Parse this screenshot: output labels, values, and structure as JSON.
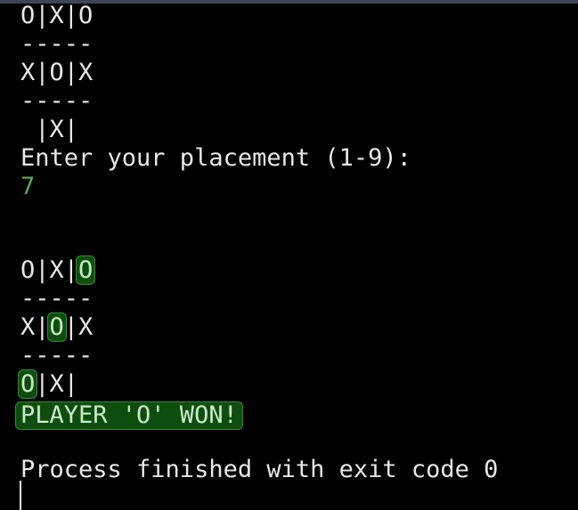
{
  "console": {
    "board_before": {
      "row1": "O|X|O",
      "sep1": "-----",
      "row2": "X|O|X",
      "sep2": "-----",
      "row3": " |X|"
    },
    "prompt": "Enter your placement (1-9):",
    "user_input": "7",
    "board_after": {
      "row1_a": "O|X|",
      "row1_win": "O",
      "sep1": "-----",
      "row2_a": "X|",
      "row2_win": "O",
      "row2_b": "|X",
      "sep2": "-----",
      "row3_win": "O",
      "row3_b": "|X|"
    },
    "result": "PLAYER 'O' WON!",
    "exit_message": "Process finished with exit code 0"
  },
  "colors": {
    "background": "#000000",
    "text": "#e8e8e8",
    "input_text": "#5aa55a",
    "highlight_bg": "#0f4d0f",
    "highlight_text": "#c6ecc6"
  }
}
